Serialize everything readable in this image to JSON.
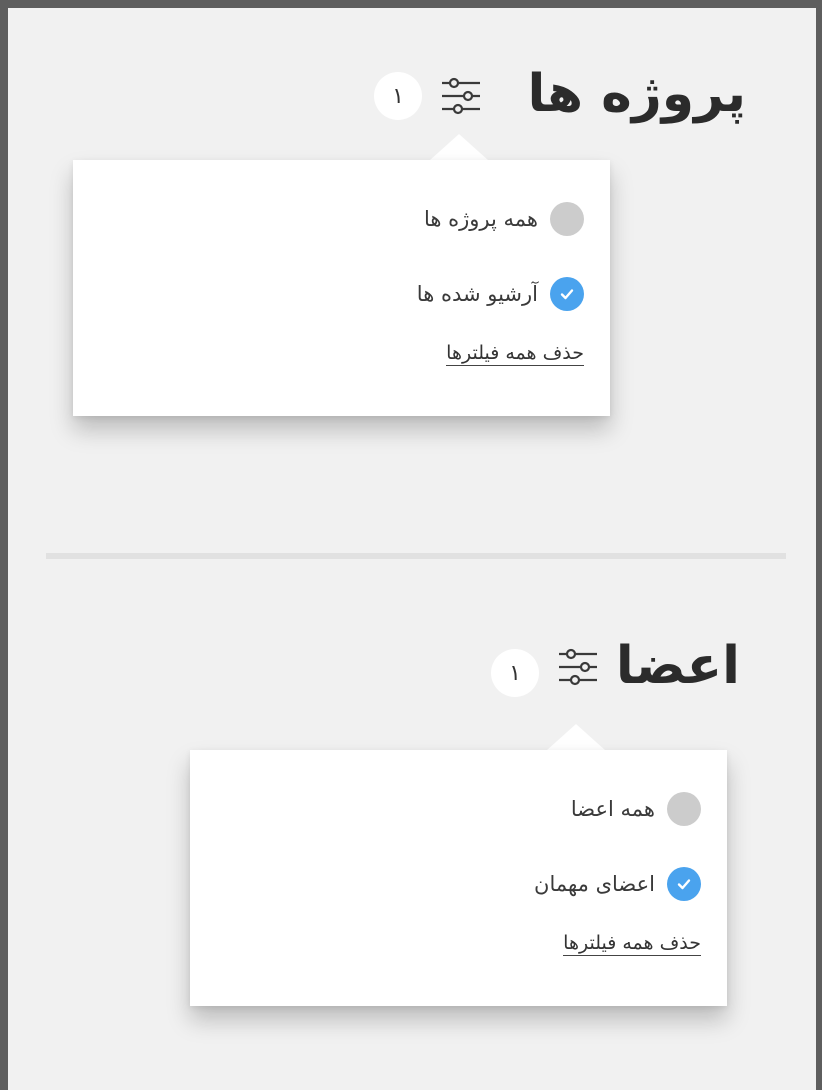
{
  "projects": {
    "title": "پروژه ها",
    "active_filter_count": "١",
    "filter_icon": "sliders-icon",
    "options": [
      {
        "label": "همه پروژه ها",
        "selected": false
      },
      {
        "label": "آرشیو شده ها",
        "selected": true
      }
    ],
    "clear_label": "حذف همه فیلترها"
  },
  "members": {
    "title": "اعضا",
    "active_filter_count": "١",
    "filter_icon": "sliders-icon",
    "options": [
      {
        "label": "همه اعضا",
        "selected": false
      },
      {
        "label": "اعضای مهمان",
        "selected": true
      }
    ],
    "clear_label": "حذف همه فیلترها"
  },
  "colors": {
    "background": "#f1f1f1",
    "frame": "#5e5e5e",
    "checked": "#4aa3ee",
    "unchecked": "#cccccc",
    "title_text": "#2b2b2b"
  }
}
